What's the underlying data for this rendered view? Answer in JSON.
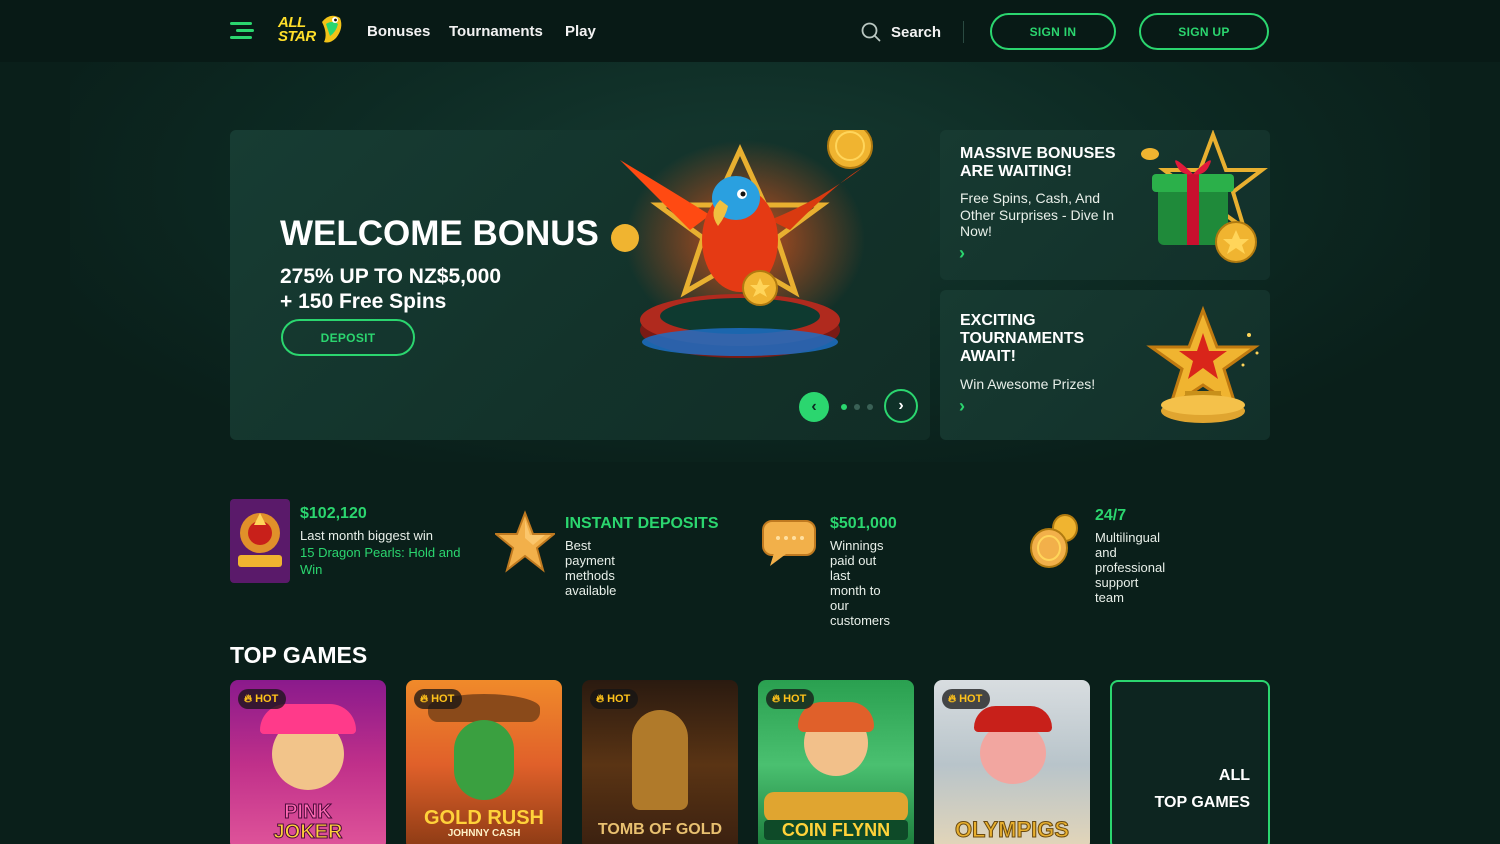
{
  "colors": {
    "accent": "#2bd66f",
    "background": "#0a1f1a",
    "hot": "#ffc21a"
  },
  "header": {
    "logo_text": "ALL STAR",
    "nav": [
      "Bonuses",
      "Tournaments",
      "Play"
    ],
    "search_label": "Search",
    "sign_in": "SIGN IN",
    "sign_up": "SIGN UP"
  },
  "hero": {
    "title": "WELCOME BONUS",
    "subtitle_line1": "275% UP TO NZ$5,000",
    "subtitle_line2": "+ 150 Free Spins",
    "button": "DEPOSIT",
    "prev_icon": "‹",
    "next_icon": "›"
  },
  "side_cards": [
    {
      "title_line1": "MASSIVE BONUSES",
      "title_line2": "ARE WAITING!",
      "text_line1": "Free Spins, Cash, And",
      "text_line2": "Other Surprises - Dive In",
      "text_line3": "Now!",
      "arrow": "›",
      "icon": "gift-icon"
    },
    {
      "title_line1": "EXCITING",
      "title_line2": "TOURNAMENTS",
      "title_line3": "AWAIT!",
      "text_line1": "Win Awesome Prizes!",
      "arrow": "›",
      "icon": "trophy-star-icon"
    }
  ],
  "features": [
    {
      "value": "$102,120",
      "text": "Last month biggest win",
      "game_line1": "15 Dragon Pearls: Hold and",
      "game_line2": "Win"
    },
    {
      "value": "INSTANT DEPOSITS",
      "text_line1": "Best payment methods",
      "text_line2": "available",
      "icon": "star-icon"
    },
    {
      "value": "$501,000",
      "text_line1": "Winnings paid out last",
      "text_line2": "month to our customers",
      "icon": "chat-bubble-icon"
    },
    {
      "value": "24/7",
      "text_line1": "Multilingual and",
      "text_line2": "professional support",
      "text_line3": "team",
      "icon": "coins-icon"
    }
  ],
  "top_games": {
    "title": "TOP GAMES",
    "badge": "HOT",
    "items": [
      {
        "name_line1": "PINK",
        "name_line2": "JOKER"
      },
      {
        "name_line1": "GOLD RUSH",
        "name_line2": "JOHNNY CASH"
      },
      {
        "name_line1": "TOMB OF GOLD"
      },
      {
        "name_line1": "COIN FLYNN"
      },
      {
        "name_line1": "OLYMPIGS"
      }
    ],
    "all_line1": "ALL",
    "all_line2": "TOP GAMES"
  }
}
